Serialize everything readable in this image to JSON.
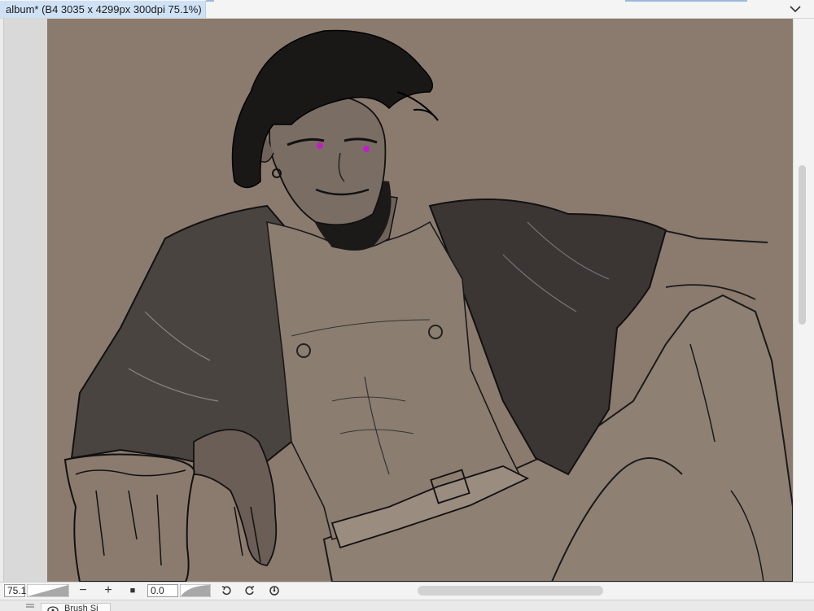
{
  "document_tab": {
    "title": "album* (B4 3035 x 4299px 300dpi 75.1%)",
    "modified_dot": "unsaved-changes-dot",
    "menu_icon": "chevron-down-icon"
  },
  "canvas": {
    "background_color": "#8b7b6e",
    "description_icon": "illustration-artwork"
  },
  "statusbar": {
    "zoom_value": "75.1",
    "zoom_out_label": "−",
    "zoom_in_label": "+",
    "fit_label": "■",
    "rotation_value": "0.0",
    "rotate_left_icon": "rotate-left-icon",
    "rotate_right_icon": "rotate-right-icon",
    "reset_rotation_icon": "reset-rotation-icon"
  },
  "panel": {
    "tab_label": "Brush Si",
    "tab_icon": "brush-size-icon"
  },
  "colors": {
    "tab_active": "#cfe2f5",
    "accent": "#9bb9dc",
    "iris": "#c11fc5"
  }
}
